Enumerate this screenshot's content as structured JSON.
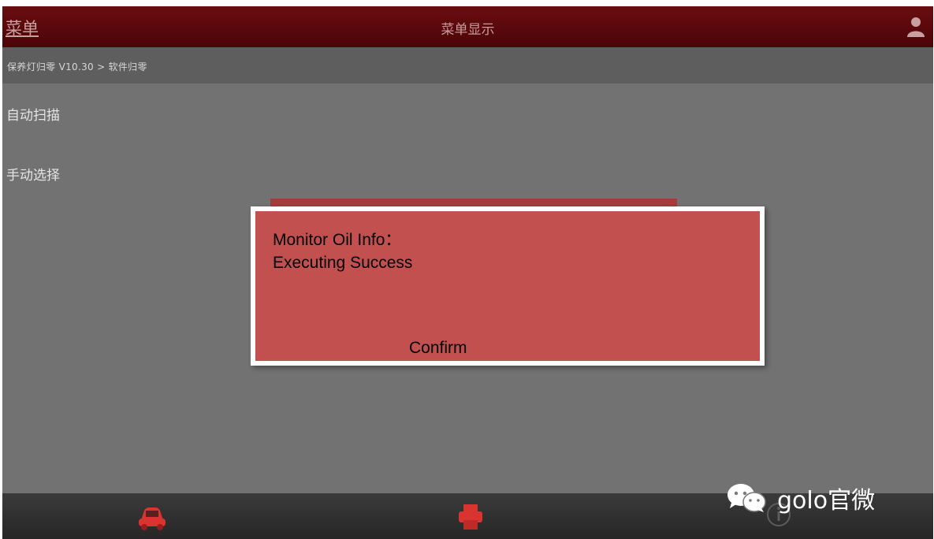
{
  "header": {
    "menu_label": "菜单",
    "title": "菜单显示",
    "user_icon": "user-icon"
  },
  "breadcrumb": "保养灯归零 V10.30 > 软件归零",
  "menu": {
    "items": [
      {
        "label": "自动扫描"
      },
      {
        "label": "手动选择"
      }
    ]
  },
  "dialog": {
    "line1": "Monitor Oil Info：",
    "line2": "Executing Success",
    "confirm_label": "Confirm"
  },
  "bottom_bar": {
    "icons": [
      "car-icon",
      "printer-icon",
      "info-icon"
    ]
  },
  "watermark": {
    "text": "golo官微",
    "icon": "wechat-icon"
  },
  "colors": {
    "title_bar": "#5a0a0c",
    "dialog_bg": "#c2504e",
    "screen_bg": "#727272",
    "accent_red": "#d9342f"
  }
}
